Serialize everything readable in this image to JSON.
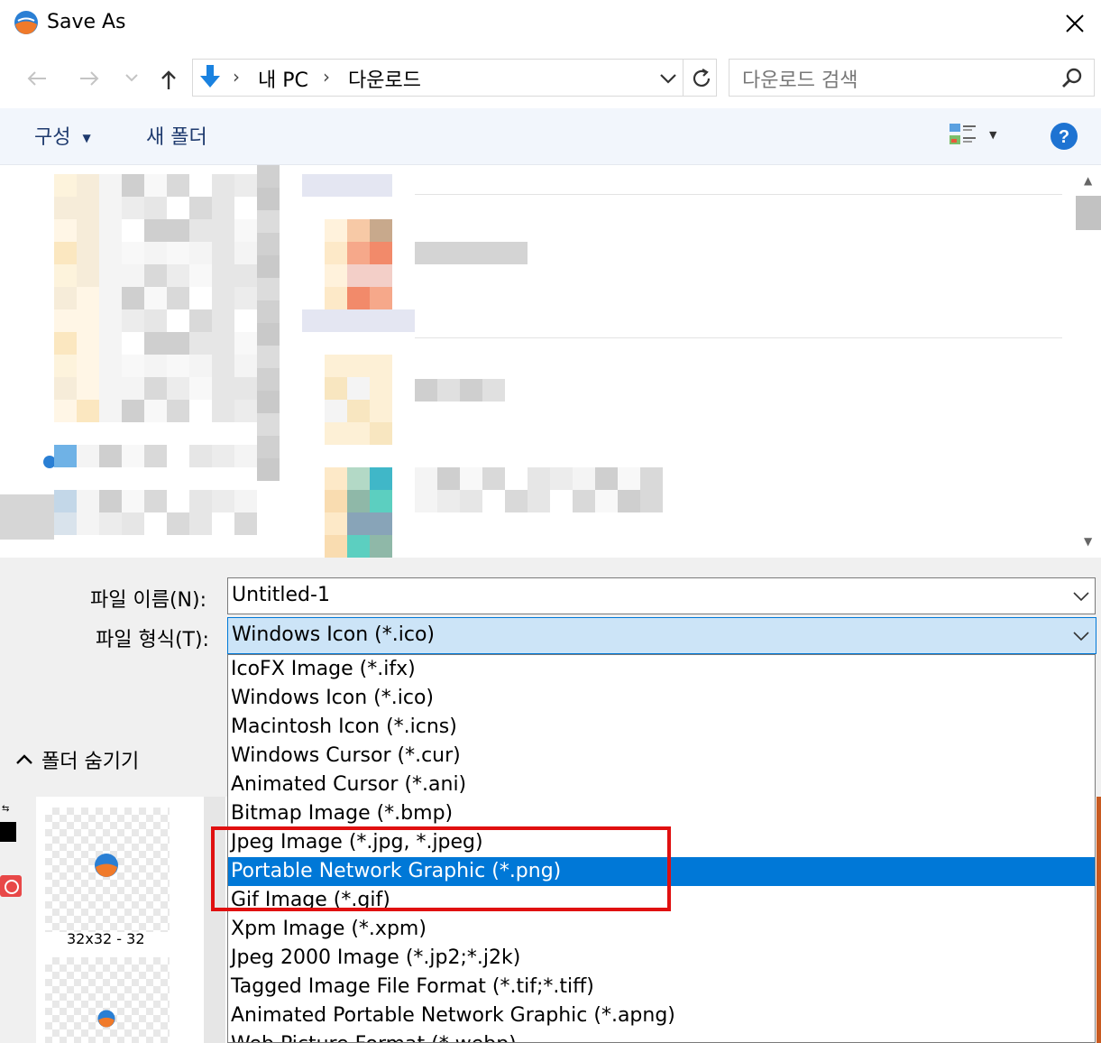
{
  "window": {
    "title": "Save As"
  },
  "nav": {
    "breadcrumb": [
      "내 PC",
      "다운로드"
    ],
    "search_placeholder": "다운로드 검색"
  },
  "toolbar": {
    "organize_label": "구성",
    "new_folder_label": "새 폴더"
  },
  "form": {
    "filename_label": "파일 이름(N):",
    "filename_value": "Untitled-1",
    "filetype_label": "파일 형식(T):",
    "filetype_value": "Windows Icon (*.ico)"
  },
  "filetype_options": [
    "IcoFX Image (*.ifx)",
    "Windows Icon (*.ico)",
    "Macintosh Icon (*.icns)",
    "Windows Cursor (*.cur)",
    "Animated Cursor (*.ani)",
    "Bitmap Image (*.bmp)",
    "Jpeg Image (*.jpg, *.jpeg)",
    "Portable Network Graphic (*.png)",
    "Gif Image (*.gif)",
    "Xpm Image (*.xpm)",
    "Jpeg 2000 Image (*.jp2;*.j2k)",
    "Tagged Image File Format (*.tif;*.tiff)",
    "Animated Portable Network Graphic (*.apng)",
    "Web Picture Format (*.webp)"
  ],
  "selected_option": "Portable Network Graphic (*.png)",
  "hide_folders_label": "폴더 숨기기",
  "background_app": {
    "thumb_label": "32x32 - 32"
  },
  "colors": {
    "accent": "#0078d7",
    "highlight_box": "#e01010",
    "help": "#1e73d2"
  }
}
